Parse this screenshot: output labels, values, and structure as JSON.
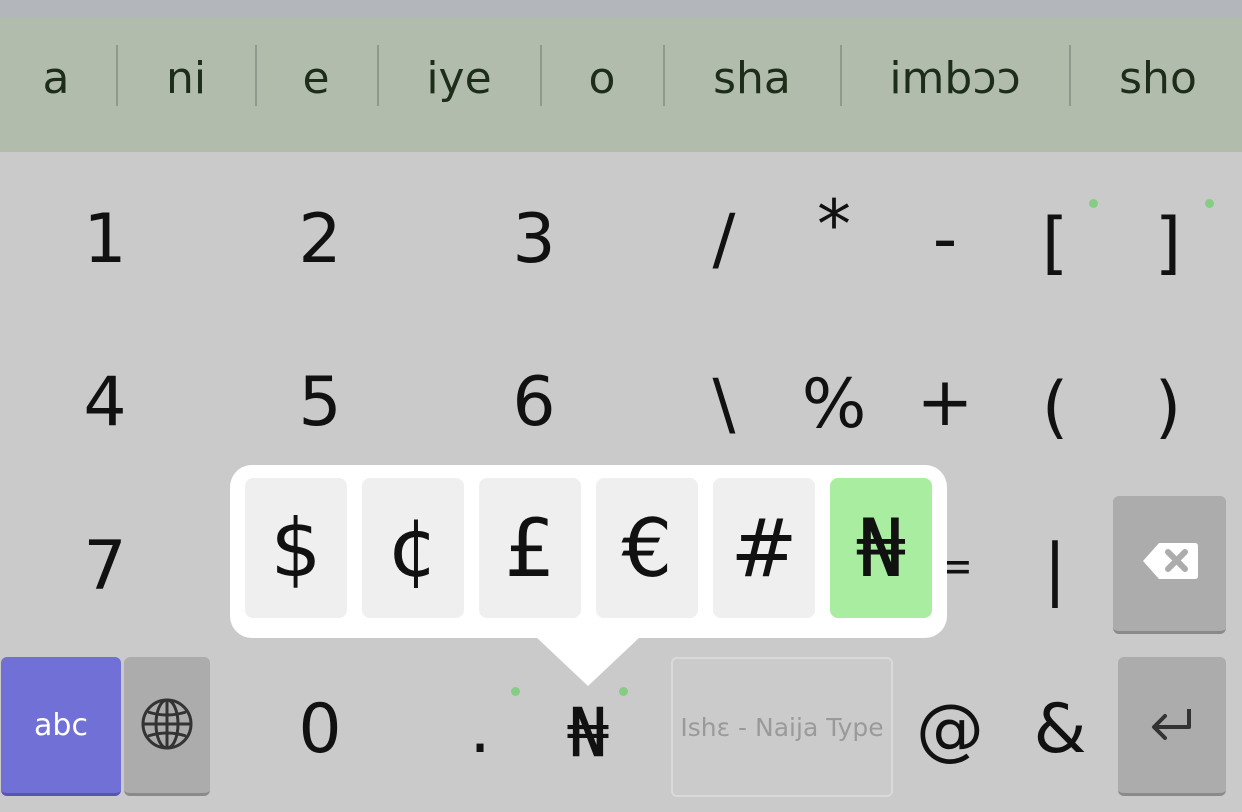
{
  "suggestions": [
    "a",
    "ni",
    "e",
    "iye",
    "o",
    "sha",
    "imbɔɔ",
    "sho"
  ],
  "rows": {
    "row1": [
      "1",
      "2",
      "3",
      "/",
      "*",
      "-",
      "[",
      "]"
    ],
    "row2": [
      "4",
      "5",
      "6",
      "\\",
      "%",
      "+",
      "(",
      ")"
    ],
    "row3": [
      "7",
      "=",
      "|"
    ],
    "row4": [
      "0",
      ".",
      "₦",
      "@",
      "&"
    ]
  },
  "popup_keys": [
    "$",
    "¢",
    "£",
    "€",
    "#",
    "₦"
  ],
  "popup_selected": "₦",
  "abc_label": "abc",
  "space_label": "Ishɛ - Naija Type",
  "icons": {
    "globe": "globe-icon",
    "backspace": "backspace-icon",
    "enter": "enter-icon"
  },
  "colors": {
    "suggestion_bar": "#b2bcad",
    "keyboard_bg": "#cacaca",
    "abc_key": "#7070d6",
    "popup_selected": "#a9eda1"
  }
}
